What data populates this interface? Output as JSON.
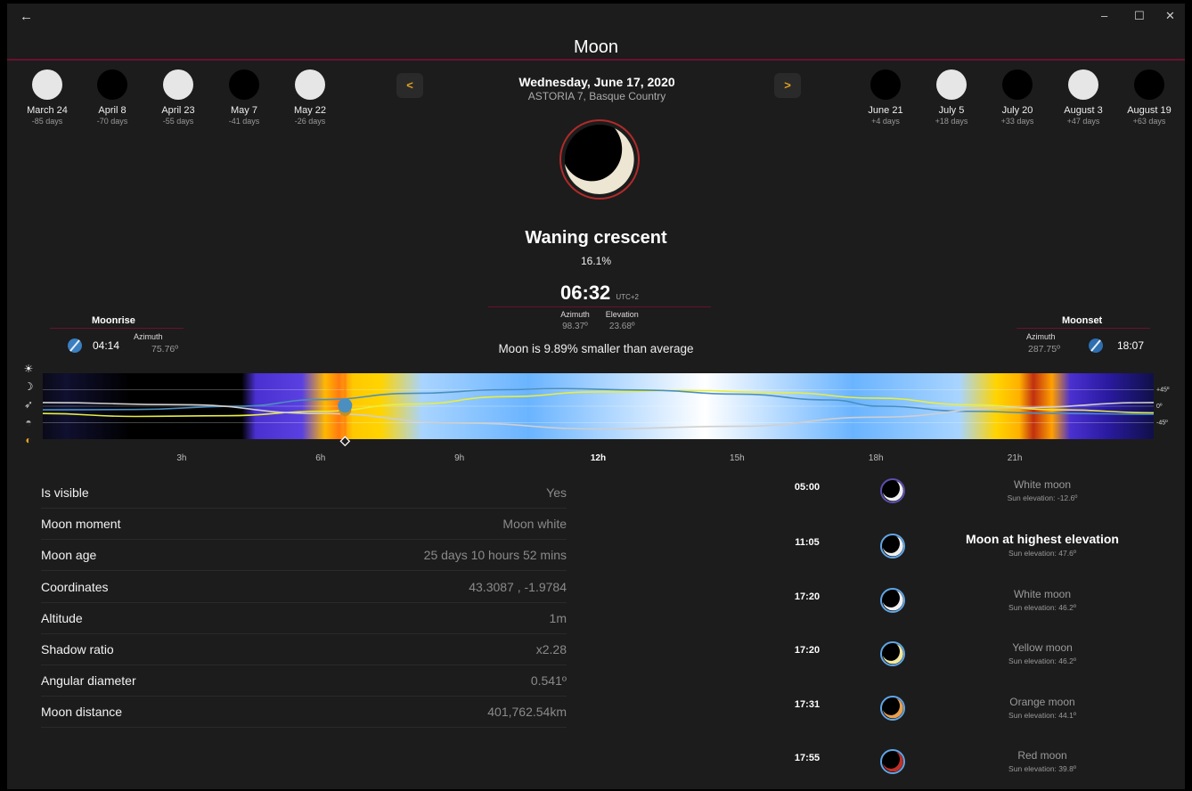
{
  "window": {
    "title": "Moon",
    "back_glyph": "←",
    "minimize_glyph": "–",
    "maximize_glyph": "☐",
    "close_glyph": "✕"
  },
  "phases_prev": [
    {
      "date": "March 24",
      "days": "-85 days",
      "type": "full"
    },
    {
      "date": "April 8",
      "days": "-70 days",
      "type": "new"
    },
    {
      "date": "April 23",
      "days": "-55 days",
      "type": "full"
    },
    {
      "date": "May 7",
      "days": "-41 days",
      "type": "new"
    },
    {
      "date": "May 22",
      "days": "-26 days",
      "type": "full"
    }
  ],
  "phases_next": [
    {
      "date": "June 21",
      "days": "+4 days",
      "type": "new"
    },
    {
      "date": "July 5",
      "days": "+18 days",
      "type": "full"
    },
    {
      "date": "July 20",
      "days": "+33 days",
      "type": "new"
    },
    {
      "date": "August 3",
      "days": "+47 days",
      "type": "full"
    },
    {
      "date": "August 19",
      "days": "+63 days",
      "type": "new"
    }
  ],
  "nav": {
    "prev_label": "<",
    "next_label": ">"
  },
  "header": {
    "date": "Wednesday, June 17, 2020",
    "location": "ASTORIA 7, Basque Country"
  },
  "current": {
    "phase_name": "Waning crescent",
    "illumination": "16.1%",
    "time": "06:32",
    "tz": "UTC+2",
    "azimuth_label": "Azimuth",
    "azimuth": "98.37º",
    "elevation_label": "Elevation",
    "elevation": "23.68º",
    "size_note": "Moon is 9.89% smaller than average"
  },
  "moonrise": {
    "label": "Moonrise",
    "time": "04:14",
    "azimuth_label": "Azimuth",
    "azimuth": "75.76º"
  },
  "moonset": {
    "label": "Moonset",
    "time": "18:07",
    "azimuth_label": "Azimuth",
    "azimuth": "287.75º"
  },
  "chart_data": {
    "type": "line",
    "x_unit": "hours of day",
    "xlim": [
      0,
      24
    ],
    "ylim": [
      -90,
      90
    ],
    "x_ticks": [
      "3h",
      "6h",
      "9h",
      "12h",
      "15h",
      "18h",
      "21h"
    ],
    "x_tick_values": [
      3,
      6,
      9,
      12,
      15,
      18,
      21
    ],
    "y_ticks": [
      "+45º",
      "0º",
      "-45º"
    ],
    "y_tick_values": [
      45,
      0,
      -45
    ],
    "series": [
      {
        "color": "#e8ee40",
        "x": [
          0,
          2,
          4,
          6,
          8,
          10,
          12,
          13.9,
          16,
          18,
          20,
          22,
          24
        ],
        "y": [
          -20,
          -28,
          -26,
          -14,
          6,
          26,
          39,
          43,
          37,
          22,
          4,
          -10,
          -18
        ]
      },
      {
        "color": "#4a8fc0",
        "x": [
          0,
          2,
          4.23,
          6,
          8,
          10,
          11.1,
          13,
          15,
          17,
          18.1,
          20,
          22,
          24
        ],
        "y": [
          -10,
          -9,
          0,
          18,
          35,
          45,
          48,
          44,
          33,
          17,
          0,
          -14,
          -20,
          -22
        ]
      },
      {
        "color": "#cfcfcf",
        "x": [
          0,
          3,
          6,
          9,
          12,
          15,
          18,
          21,
          24
        ],
        "y": [
          10,
          4,
          -20,
          -46,
          -62,
          -55,
          -30,
          -4,
          10
        ]
      }
    ],
    "marker_time": 6.53,
    "daylight_gradient": [
      {
        "t": 0,
        "color": "#0a0a18"
      },
      {
        "t": 0.5,
        "color": "#101030"
      },
      {
        "t": 1.9,
        "color": "#000000"
      },
      {
        "t": 4.3,
        "color": "#000000"
      },
      {
        "t": 4.6,
        "color": "#4a30d0"
      },
      {
        "t": 5.6,
        "color": "#5a40e0"
      },
      {
        "t": 6.1,
        "color": "#ffb800"
      },
      {
        "t": 6.4,
        "color": "#ff7a10"
      },
      {
        "t": 6.7,
        "color": "#ffc800"
      },
      {
        "t": 7.3,
        "color": "#ffd400"
      },
      {
        "t": 8.2,
        "color": "#a8d4ff"
      },
      {
        "t": 10.5,
        "color": "#6ab4ff"
      },
      {
        "t": 14.3,
        "color": "#ffffff"
      },
      {
        "t": 17.5,
        "color": "#6ab4ff"
      },
      {
        "t": 19.8,
        "color": "#a8d4ff"
      },
      {
        "t": 20.6,
        "color": "#ffd400"
      },
      {
        "t": 21.1,
        "color": "#ffb000"
      },
      {
        "t": 21.4,
        "color": "#c03010"
      },
      {
        "t": 21.8,
        "color": "#ffa000"
      },
      {
        "t": 22.2,
        "color": "#4a30d0"
      },
      {
        "t": 23.0,
        "color": "#2a1aa0"
      },
      {
        "t": 24,
        "color": "#101048"
      }
    ]
  },
  "details": [
    {
      "label": "Is visible",
      "value": "Yes"
    },
    {
      "label": "Moon moment",
      "value": "Moon white"
    },
    {
      "label": "Moon age",
      "value": "25 days 10 hours 52 mins"
    },
    {
      "label": "Coordinates",
      "value": "43.3087 , -1.9784"
    },
    {
      "label": "Altitude",
      "value": "1m"
    },
    {
      "label": "Shadow ratio",
      "value": "x2.28"
    },
    {
      "label": "Angular diameter",
      "value": "0.541º"
    },
    {
      "label": "Moon distance",
      "value": "401,762.54km"
    }
  ],
  "moments": [
    {
      "time": "05:00",
      "title": "White moon",
      "sub": "Sun elevation: -12.6º",
      "color": "#f0f0f0",
      "ring": "#5b4fb0",
      "highlight": false
    },
    {
      "time": "11:05",
      "title": "Moon at highest elevation",
      "sub": "Sun elevation: 47.6º",
      "color": "#f0f0f0",
      "ring": "#5fa6e8",
      "highlight": true
    },
    {
      "time": "17:20",
      "title": "White moon",
      "sub": "Sun elevation: 46.2º",
      "color": "#f0f0f0",
      "ring": "#5fa6e8",
      "highlight": false
    },
    {
      "time": "17:20",
      "title": "Yellow moon",
      "sub": "Sun elevation: 46.2º",
      "color": "#f2e9a0",
      "ring": "#5fa6e8",
      "highlight": false
    },
    {
      "time": "17:31",
      "title": "Orange moon",
      "sub": "Sun elevation: 44.1º",
      "color": "#e8a050",
      "ring": "#5fa6e8",
      "highlight": false
    },
    {
      "time": "17:55",
      "title": "Red moon",
      "sub": "Sun elevation: 39.8º",
      "color": "#c03028",
      "ring": "#5fa6e8",
      "highlight": false
    }
  ],
  "icons": {
    "legend": [
      "sun-icon",
      "moon-icon",
      "satellite-icon",
      "horizon-icon",
      "phase-icon"
    ],
    "legend_glyphs": [
      "☀",
      "☽",
      "➶",
      "◓",
      "◐"
    ]
  }
}
